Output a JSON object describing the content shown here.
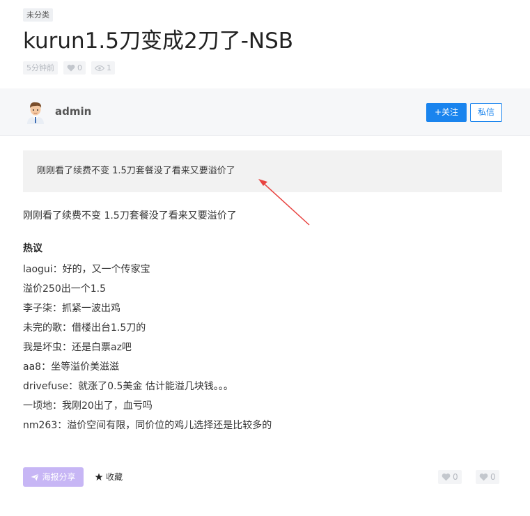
{
  "post": {
    "category": "未分类",
    "title": "kurun1.5刀变成2刀了-NSB",
    "time_ago": "5分钟前",
    "likes": "0",
    "views": "1"
  },
  "author": {
    "name": "admin",
    "follow_label": "+关注",
    "message_label": "私信"
  },
  "content": {
    "quote": "刚刚看了续费不变 1.5刀套餐没了看来又要溢价了",
    "paragraph": "刚刚看了续费不变 1.5刀套餐没了看来又要溢价了",
    "hot_heading": "热议",
    "comments": [
      "laogui：好的，又一个传家宝",
      "溢价250出一个1.5",
      "李子柒：抓紧一波出鸡",
      "未完的歌：借楼出台1.5刀的",
      "我是坏虫：还是白票az吧",
      "aa8：坐等溢价美滋滋",
      "drivefuse：就涨了0.5美金 估计能溢几块钱。。。",
      "一顷地：我刚20出了，血亏吗",
      "nm263：溢价空间有限，同价位的鸡儿选择还是比较多的"
    ]
  },
  "footer": {
    "share_label": "海报分享",
    "favorite_label": "收藏",
    "like_count": "0",
    "like_count_2": "0"
  },
  "icons": {
    "heart": "heart-icon",
    "eye": "eye-icon",
    "star": "star-icon",
    "send": "send-icon",
    "arrow": "annotation-arrow"
  },
  "colors": {
    "accent": "#1a84ee",
    "share_button": "#c7b6f5",
    "annotation": "#e8423f"
  }
}
